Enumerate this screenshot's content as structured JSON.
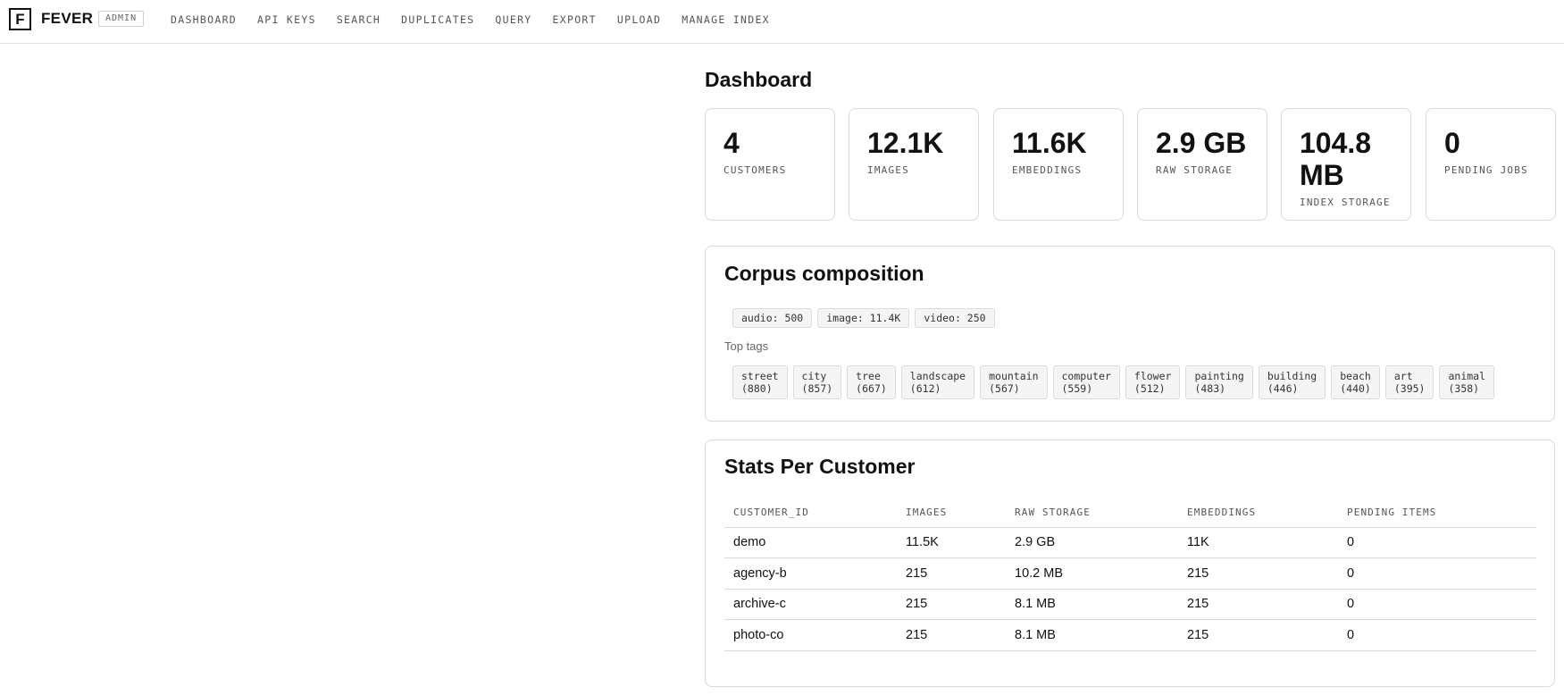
{
  "header": {
    "logo_letter": "F",
    "brand": "FEVER",
    "badge": "ADMIN",
    "nav": [
      "DASHBOARD",
      "API KEYS",
      "SEARCH",
      "DUPLICATES",
      "QUERY",
      "EXPORT",
      "UPLOAD",
      "MANAGE INDEX"
    ]
  },
  "page": {
    "title": "Dashboard"
  },
  "stats": [
    {
      "value": "4",
      "label": "CUSTOMERS"
    },
    {
      "value": "12.1K",
      "label": "IMAGES"
    },
    {
      "value": "11.6K",
      "label": "EMBEDDINGS"
    },
    {
      "value": "2.9 GB",
      "label": "RAW STORAGE"
    },
    {
      "value": "104.8 MB",
      "label": "INDEX STORAGE"
    },
    {
      "value": "0",
      "label": "PENDING JOBS"
    }
  ],
  "corpus": {
    "title": "Corpus composition",
    "media_types": [
      "audio: 500",
      "image: 11.4K",
      "video: 250"
    ],
    "top_tags_label": "Top tags",
    "tags": [
      {
        "name": "street",
        "count": "(880)"
      },
      {
        "name": "city",
        "count": "(857)"
      },
      {
        "name": "tree",
        "count": "(667)"
      },
      {
        "name": "landscape",
        "count": "(612)"
      },
      {
        "name": "mountain",
        "count": "(567)"
      },
      {
        "name": "computer",
        "count": "(559)"
      },
      {
        "name": "flower",
        "count": "(512)"
      },
      {
        "name": "painting",
        "count": "(483)"
      },
      {
        "name": "building",
        "count": "(446)"
      },
      {
        "name": "beach",
        "count": "(440)"
      },
      {
        "name": "art",
        "count": "(395)"
      },
      {
        "name": "animal",
        "count": "(358)"
      }
    ]
  },
  "customers": {
    "title": "Stats Per Customer",
    "columns": [
      "CUSTOMER_ID",
      "IMAGES",
      "RAW STORAGE",
      "EMBEDDINGS",
      "PENDING ITEMS"
    ],
    "rows": [
      [
        "demo",
        "11.5K",
        "2.9 GB",
        "11K",
        "0"
      ],
      [
        "agency-b",
        "215",
        "10.2 MB",
        "215",
        "0"
      ],
      [
        "archive-c",
        "215",
        "8.1 MB",
        "215",
        "0"
      ],
      [
        "photo-co",
        "215",
        "8.1 MB",
        "215",
        "0"
      ]
    ]
  }
}
